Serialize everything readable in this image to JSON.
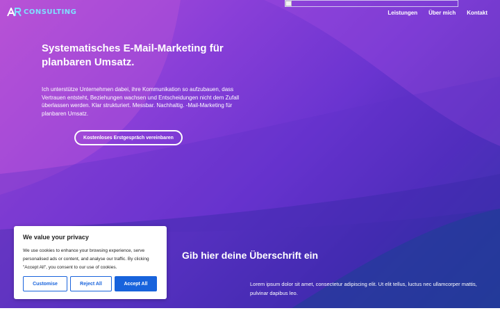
{
  "brand": {
    "logo_text": "CONSULTING",
    "logo_color": "#7fe0ff"
  },
  "nav": {
    "items": [
      {
        "label": "Leistungen"
      },
      {
        "label": "Über mich"
      },
      {
        "label": "Kontakt"
      }
    ]
  },
  "hero": {
    "title": "Systematisches E-Mail-Marketing für planbaren Umsatz.",
    "text": "Ich unterstütze Unternehmen dabei, ihre Kommunikation so aufzubauen, dass Vertrauen entsteht, Beziehungen wachsen und Entscheidungen nicht dem Zufall überlassen werden. Klar strukturiert. Messbar. Nachhaltig. -Mail-Marketing für planbaren Umsatz.",
    "cta_label": "Kostenloses Erstgespräch vereinbaren"
  },
  "section": {
    "title": "Gib hier deine Überschrift ein",
    "text": "Lorem ipsum dolor sit amet, consectetur adipiscing elit. Ut elit tellus, luctus nec ullamcorper mattis, pulvinar dapibus leo."
  },
  "cookie": {
    "title": "We value your privacy",
    "text": "We use cookies to enhance your browsing experience, serve personalised ads or content, and analyse our traffic. By clicking \"Accept All\", you consent to our use of cookies.",
    "customise_label": "Customise",
    "reject_label": "Reject All",
    "accept_label": "Accept All",
    "accent_color": "#1863dc"
  },
  "colors": {
    "gradient_start": "#b34fd6",
    "gradient_mid": "#6a34d0",
    "gradient_end": "#1f3a98"
  }
}
